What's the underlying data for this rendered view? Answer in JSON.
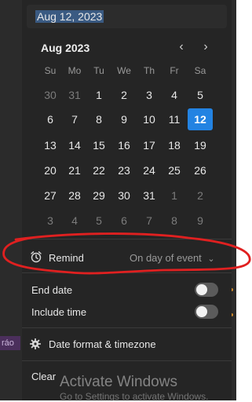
{
  "date_input": {
    "value": "Aug 12, 2023"
  },
  "calendar": {
    "month_title": "Aug 2023",
    "prev_icon": "chevron-left-icon",
    "next_icon": "chevron-right-icon",
    "weekdays": [
      "Su",
      "Mo",
      "Tu",
      "We",
      "Th",
      "Fr",
      "Sa"
    ],
    "weeks": [
      [
        "30",
        "31",
        "1",
        "2",
        "3",
        "4",
        "5"
      ],
      [
        "6",
        "7",
        "8",
        "9",
        "10",
        "11",
        "12"
      ],
      [
        "13",
        "14",
        "15",
        "16",
        "17",
        "18",
        "19"
      ],
      [
        "20",
        "21",
        "22",
        "23",
        "24",
        "25",
        "26"
      ],
      [
        "27",
        "28",
        "29",
        "30",
        "31",
        "1",
        "2"
      ],
      [
        "3",
        "4",
        "5",
        "6",
        "7",
        "8",
        "9"
      ]
    ],
    "selected": "12"
  },
  "remind": {
    "label": "Remind",
    "value": "On day of event",
    "icon": "alarm-clock-icon",
    "annotation_color": "#e02020"
  },
  "end_date": {
    "label": "End date"
  },
  "include_time": {
    "label": "Include time"
  },
  "date_format": {
    "label": "Date format & timezone",
    "icon": "gear-icon"
  },
  "clear": {
    "label": "Clear"
  },
  "edge_tag": {
    "text": "ráo"
  },
  "watermark": {
    "title": "Activate Windows",
    "subtitle": "Go to Settings to activate Windows."
  },
  "colors": {
    "accent": "#2383e2",
    "panel": "#252525"
  }
}
